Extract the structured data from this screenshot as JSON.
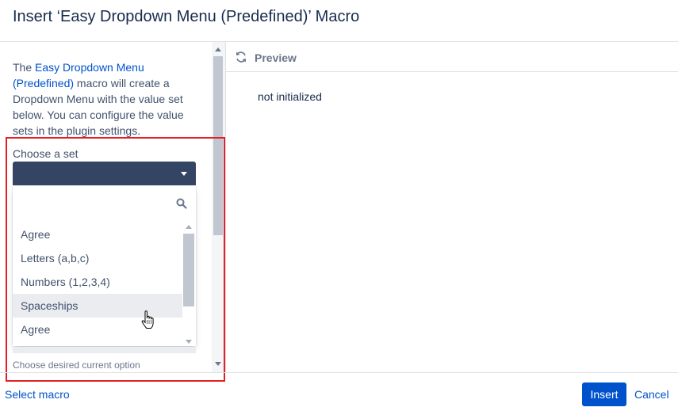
{
  "dialog": {
    "title": "Insert ‘Easy Dropdown Menu (Predefined)’ Macro"
  },
  "sidebar": {
    "intro_prefix": "The ",
    "intro_link": "Easy Dropdown Menu (Predefined)",
    "intro_suffix": " macro will create a Dropdown Menu with the value set below. You can configure the value sets in the plugin settings.",
    "choose_label": "Choose a set",
    "selected_value": "",
    "search_value": "",
    "options": [
      "Agree",
      "Letters (a,b,c)",
      "Numbers (1,2,3,4)",
      "Spaceships",
      "Agree"
    ],
    "hovered_index": 3,
    "helper_text": "Choose desired current option"
  },
  "preview": {
    "title": "Preview",
    "status": "not initialized"
  },
  "footer": {
    "select_macro_label": "Select macro",
    "insert_label": "Insert",
    "cancel_label": "Cancel"
  },
  "colors": {
    "accent": "#0052cc",
    "select_bg": "#344563",
    "highlight_border": "#e31e24",
    "hover_bg": "#ebecf0"
  }
}
